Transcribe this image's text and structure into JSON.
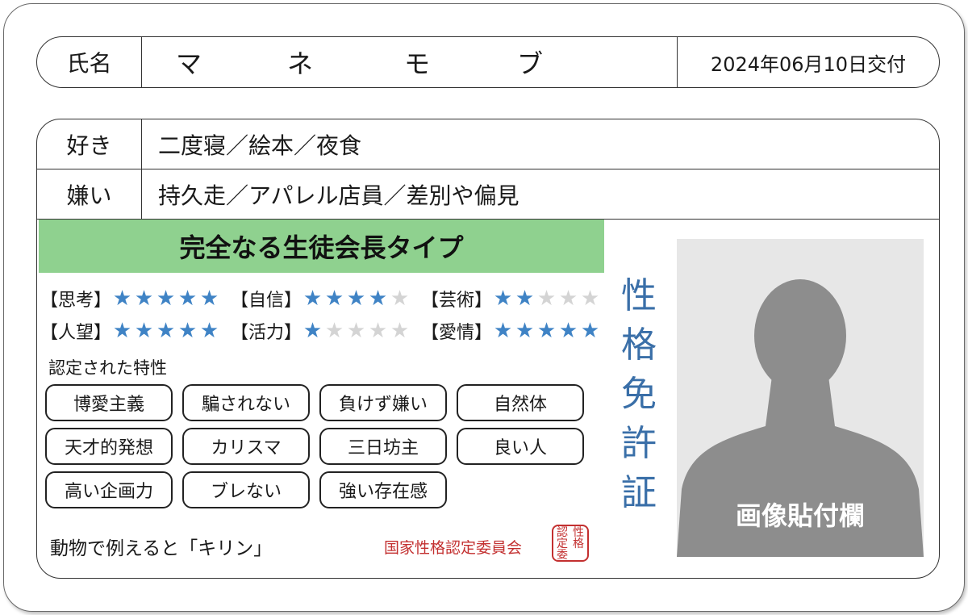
{
  "name_row": {
    "label": "氏名",
    "chars": [
      "マ",
      "ネ",
      "モ",
      "ブ"
    ],
    "issued": "2024年06月10日交付"
  },
  "likes": {
    "label": "好き",
    "value": "二度寝／絵本／夜食"
  },
  "dislikes": {
    "label": "嫌い",
    "value": "持久走／アパレル店員／差別や偏見"
  },
  "type_title": "完全なる生徒会長タイプ",
  "stats": [
    {
      "label": "【思考】",
      "rating": 5
    },
    {
      "label": "【自信】",
      "rating": 4
    },
    {
      "label": "【芸術】",
      "rating": 2
    },
    {
      "label": "【人望】",
      "rating": 5
    },
    {
      "label": "【活力】",
      "rating": 1
    },
    {
      "label": "【愛情】",
      "rating": 5
    }
  ],
  "stars_max": 5,
  "traits_title": "認定された特性",
  "traits": [
    "博愛主義",
    "騙されない",
    "負けず嫌い",
    "自然体",
    "天才的発想",
    "カリスマ",
    "三日坊主",
    "良い人",
    "高い企画力",
    "ブレない",
    "強い存在感"
  ],
  "animal": "動物で例えると「キリン」",
  "committee": "国家性格認定委員会",
  "seal_chars": [
    "認",
    "性",
    "定",
    "格",
    "委",
    ""
  ],
  "license_title": [
    "性",
    "格",
    "免",
    "許",
    "証"
  ],
  "photo_caption": "画像貼付欄",
  "colors": {
    "accent_green": "#8fd18f",
    "star_blue": "#3f83c5",
    "title_blue": "#3a6fa8",
    "seal_red": "#c33030"
  }
}
